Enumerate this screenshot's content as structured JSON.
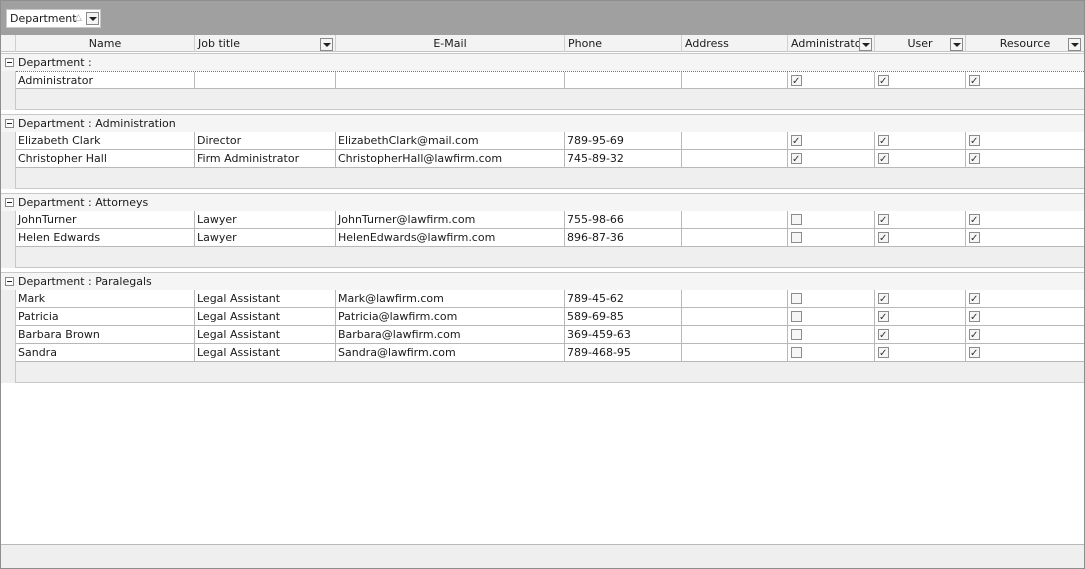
{
  "group_panel": {
    "chip_label": "Department",
    "sort_icon": "sort-ascending-icon"
  },
  "columns": {
    "name": "Name",
    "job_title": "Job title",
    "email": "E-Mail",
    "phone": "Phone",
    "address": "Address",
    "administrator": "Administrator",
    "user": "User",
    "resource": "Resource"
  },
  "groups": [
    {
      "label": "Department :",
      "rows": [
        {
          "name": "Administrator",
          "job_title": "",
          "email": "",
          "phone": "",
          "address": "",
          "administrator": true,
          "user": true,
          "resource": true
        }
      ]
    },
    {
      "label": "Department : Administration",
      "rows": [
        {
          "name": "Elizabeth Clark",
          "job_title": "Director",
          "email": "ElizabethClark@mail.com",
          "phone": "789-95-69",
          "address": "",
          "administrator": true,
          "user": true,
          "resource": true
        },
        {
          "name": "Christopher Hall",
          "job_title": "Firm Administrator",
          "email": "ChristopherHall@lawfirm.com",
          "phone": "745-89-32",
          "address": "",
          "administrator": true,
          "user": true,
          "resource": true
        }
      ]
    },
    {
      "label": "Department : Attorneys",
      "rows": [
        {
          "name": "JohnTurner",
          "job_title": "Lawyer",
          "email": "JohnTurner@lawfirm.com",
          "phone": "755-98-66",
          "address": "",
          "administrator": false,
          "user": true,
          "resource": true
        },
        {
          "name": "Helen Edwards",
          "job_title": "Lawyer",
          "email": "HelenEdwards@lawfirm.com",
          "phone": "896-87-36",
          "address": "",
          "administrator": false,
          "user": true,
          "resource": true
        }
      ]
    },
    {
      "label": "Department : Paralegals",
      "rows": [
        {
          "name": "Mark",
          "job_title": "Legal Assistant",
          "email": "Mark@lawfirm.com",
          "phone": "789-45-62",
          "address": "",
          "administrator": false,
          "user": true,
          "resource": true
        },
        {
          "name": "Patricia",
          "job_title": "Legal Assistant",
          "email": "Patricia@lawfirm.com",
          "phone": "589-69-85",
          "address": "",
          "administrator": false,
          "user": true,
          "resource": true
        },
        {
          "name": "Barbara Brown",
          "job_title": "Legal Assistant",
          "email": "Barbara@lawfirm.com",
          "phone": "369-459-63",
          "address": "",
          "administrator": false,
          "user": true,
          "resource": true
        },
        {
          "name": "Sandra",
          "job_title": "Legal Assistant",
          "email": "Sandra@lawfirm.com",
          "phone": "789-468-95",
          "address": "",
          "administrator": false,
          "user": true,
          "resource": true
        }
      ]
    }
  ]
}
